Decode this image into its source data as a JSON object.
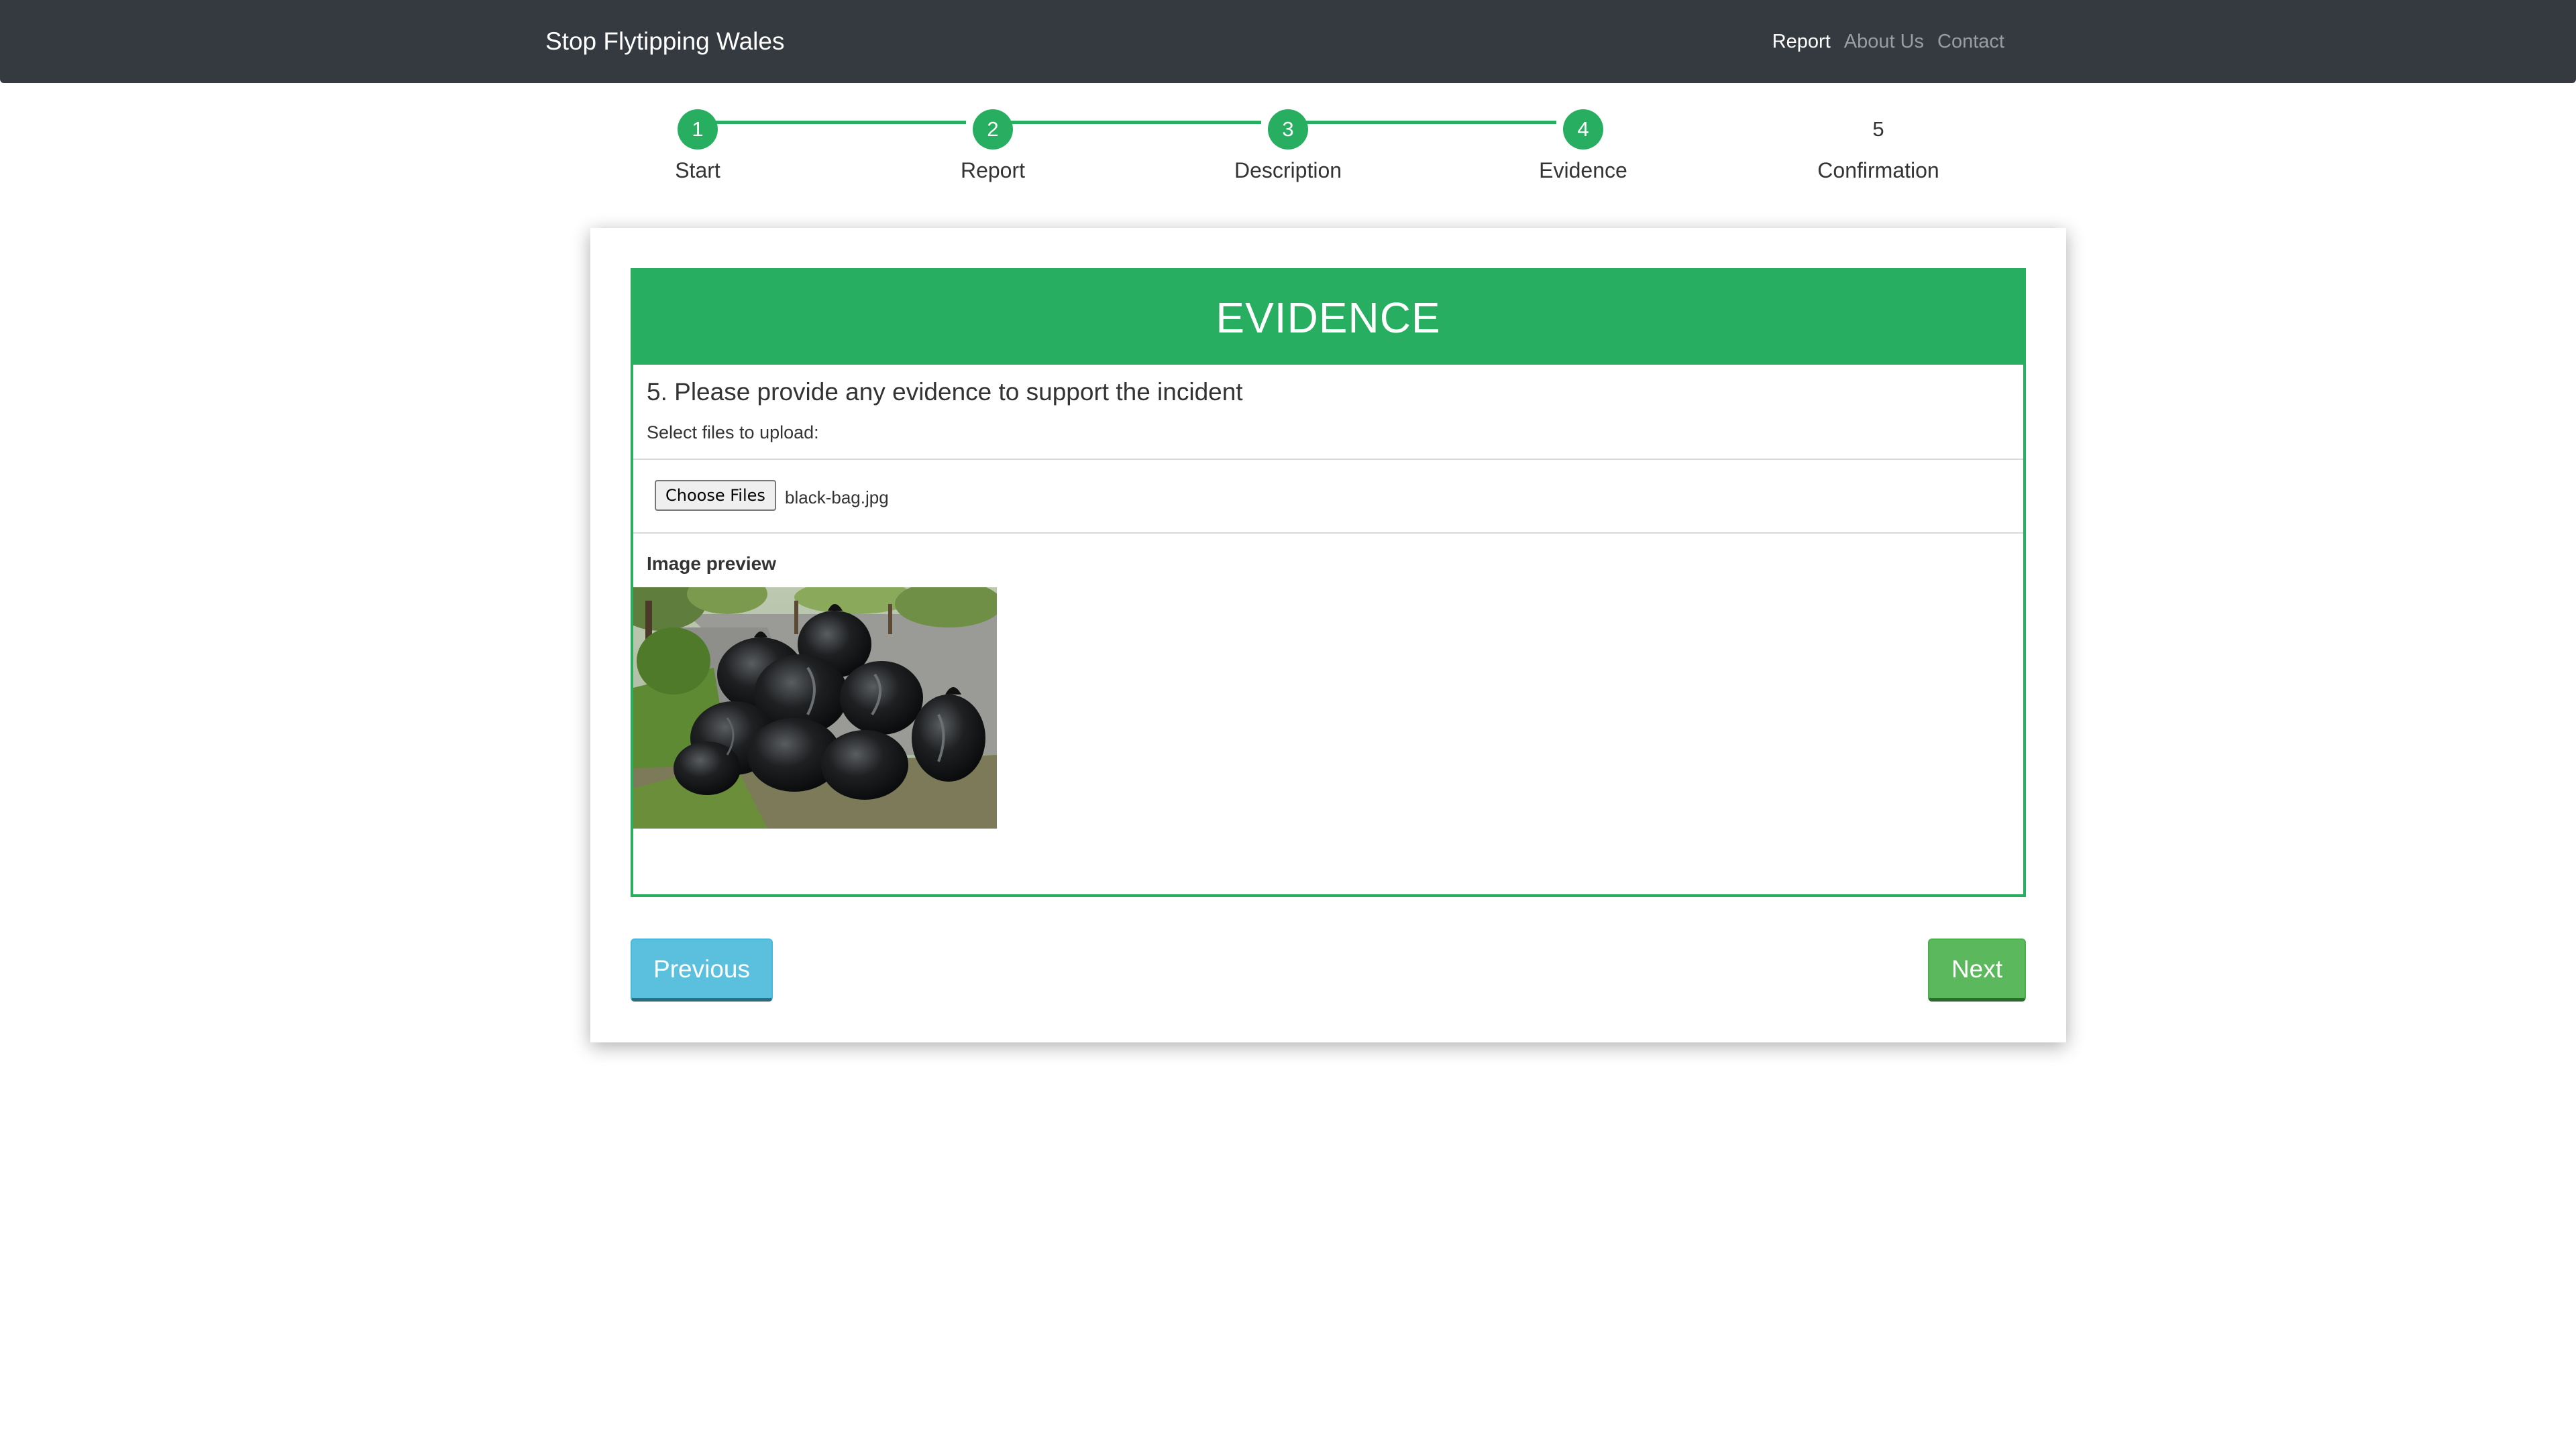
{
  "navbar": {
    "brand": "Stop Flytipping Wales",
    "links": [
      {
        "label": "Report",
        "active": true
      },
      {
        "label": "About Us",
        "active": false
      },
      {
        "label": "Contact",
        "active": false
      }
    ]
  },
  "stepper": {
    "current_step": 4,
    "steps": [
      {
        "number": "1",
        "label": "Start",
        "completed": true
      },
      {
        "number": "2",
        "label": "Report",
        "completed": true
      },
      {
        "number": "3",
        "label": "Description",
        "completed": true
      },
      {
        "number": "4",
        "label": "Evidence",
        "completed": true
      },
      {
        "number": "5",
        "label": "Confirmation",
        "completed": false
      }
    ]
  },
  "panel": {
    "title": "EVIDENCE",
    "question": "5. Please provide any evidence to support the incident",
    "upload_label": "Select files to upload:",
    "choose_button": "Choose Files",
    "file_name": "black-bag.jpg",
    "preview_label": "Image preview"
  },
  "buttons": {
    "previous": "Previous",
    "next": "Next"
  },
  "colors": {
    "navbar": "#343a40",
    "accent_green": "#27ae60",
    "previous_button": "#5bc0de",
    "next_button": "#5cb85c"
  }
}
